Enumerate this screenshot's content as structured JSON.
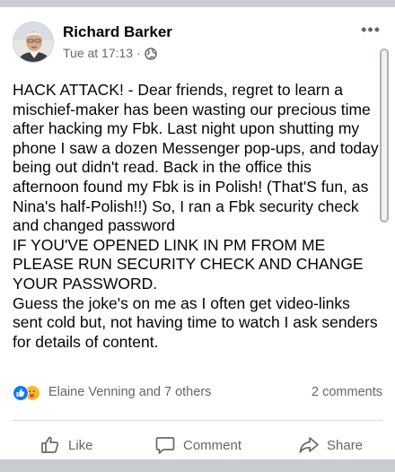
{
  "post": {
    "author": "Richard Barker",
    "timestamp": "Tue at 17:13",
    "meta_separator": "·",
    "privacy_icon": "globe-icon",
    "more_label": "•••",
    "text": "HACK ATTACK! - Dear friends, regret to learn a mischief-maker has been wasting our precious time after hacking my Fbk. Last night upon shutting my phone I saw a dozen Messenger pop-ups, and today being out didn't read. Back in the office this afternoon found my Fbk is in Polish! (That'S fun, as Nina's half-Polish!!)  So, I ran a Fbk security check and changed password\nIF YOU'VE OPENED LINK IN PM FROM ME PLEASE RUN SECURITY CHECK AND CHANGE YOUR PASSWORD.\nGuess the joke's on me as I often get video-links sent cold but, not having time to watch I ask senders for details of content."
  },
  "reactions": {
    "icons": [
      "like-reaction-icon",
      "care-reaction-icon"
    ],
    "summary": "Elaine Venning and 7 others",
    "comments": "2 comments"
  },
  "actions": {
    "like": "Like",
    "comment": "Comment",
    "share": "Share"
  },
  "colors": {
    "page_background": "#c9ccd1",
    "card_background": "#ffffff",
    "primary_text": "#050505",
    "secondary_text": "#65676b",
    "like_blue": "#1877f2"
  }
}
